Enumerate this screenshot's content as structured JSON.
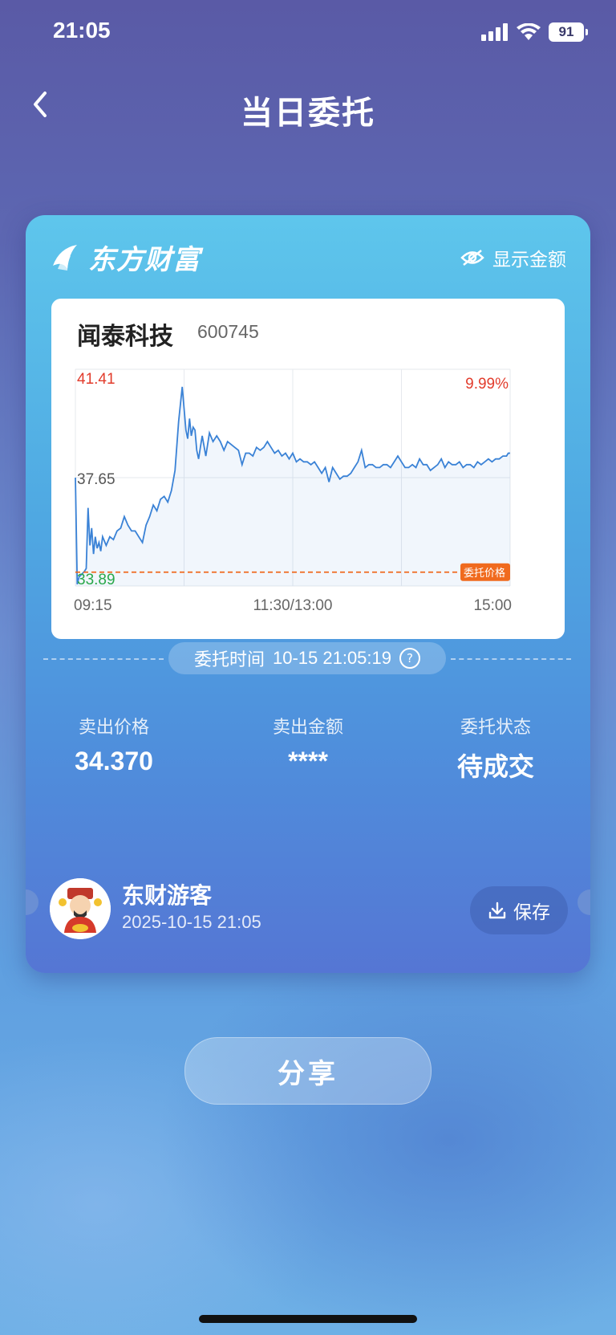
{
  "status_bar": {
    "time": "21:05",
    "battery": "91"
  },
  "nav": {
    "title": "当日委托"
  },
  "card": {
    "brand": "东方财富",
    "show_amount_label": "显示金额",
    "stock": {
      "name": "闻泰科技",
      "code": "600745"
    },
    "entrust_time_label": "委托时间",
    "entrust_time": "10-15 21:05:19",
    "stats": [
      {
        "label": "卖出价格",
        "value": "34.370"
      },
      {
        "label": "卖出金额",
        "value": "****"
      },
      {
        "label": "委托状态",
        "value": "待成交"
      }
    ],
    "user": {
      "name": "东财游客",
      "time": "2025-10-15 21:05"
    },
    "save_label": "保存"
  },
  "share_label": "分享",
  "colors": {
    "up": "#e23c2c",
    "down": "#2aa84a",
    "line": "#3a82d6",
    "entrust": "#f06a1e"
  },
  "chart_data": {
    "type": "line",
    "x_ticks": [
      "09:15",
      "11:30/13:00",
      "15:00"
    ],
    "y_high": "41.41",
    "y_mid": "37.65",
    "y_low": "33.89",
    "pct_high": "9.99%",
    "ylim": [
      33.89,
      41.41
    ],
    "entrust_price": 34.37,
    "entrust_label": "委托价格",
    "series": [
      {
        "x": [
          0,
          1,
          2,
          5,
          6,
          7,
          8,
          9,
          10,
          11,
          12,
          13,
          14,
          15,
          17,
          19,
          21,
          23,
          25,
          27,
          29,
          31,
          33,
          35,
          37,
          39,
          41,
          43,
          45,
          47,
          49,
          51,
          53,
          55,
          57,
          59,
          61,
          62,
          63,
          64,
          65,
          66,
          67,
          68,
          69,
          70,
          72,
          74,
          76,
          78,
          80,
          82,
          84,
          86,
          88,
          90,
          92,
          94,
          96,
          98,
          100,
          102,
          104,
          106,
          108,
          110,
          112,
          114,
          116,
          118,
          120,
          122,
          124,
          126,
          128,
          130,
          132,
          134,
          136,
          138,
          140,
          142,
          144,
          146,
          148,
          150,
          152,
          154,
          156,
          158,
          160,
          162,
          164,
          166,
          168,
          170,
          172,
          174,
          176,
          178,
          180,
          182,
          184,
          186,
          188,
          190,
          192,
          194,
          196,
          198,
          200,
          202,
          204,
          206,
          208,
          210,
          212,
          214,
          216,
          218,
          220,
          222,
          224,
          226,
          228,
          230,
          232,
          234,
          236,
          238,
          239,
          240
        ],
        "values": [
          37.65,
          33.95,
          34.2,
          34.4,
          34.5,
          36.6,
          35.3,
          35.9,
          35.0,
          35.6,
          35.2,
          35.4,
          35.1,
          35.6,
          35.3,
          35.6,
          35.5,
          35.8,
          35.9,
          36.3,
          36.0,
          35.8,
          35.8,
          35.6,
          35.4,
          36.0,
          36.3,
          36.7,
          36.5,
          36.9,
          37.0,
          36.8,
          37.2,
          37.9,
          39.6,
          40.8,
          39.3,
          39.0,
          39.7,
          39.1,
          39.4,
          39.3,
          38.6,
          38.3,
          38.7,
          39.1,
          38.4,
          39.2,
          38.9,
          39.1,
          38.9,
          38.6,
          38.9,
          38.8,
          38.7,
          38.6,
          38.1,
          38.5,
          38.5,
          38.4,
          38.7,
          38.6,
          38.7,
          38.9,
          38.7,
          38.5,
          38.6,
          38.4,
          38.5,
          38.3,
          38.5,
          38.2,
          38.3,
          38.2,
          38.2,
          38.1,
          38.2,
          38.0,
          37.8,
          38.0,
          37.5,
          38.0,
          37.8,
          37.6,
          37.7,
          37.7,
          37.8,
          38.0,
          38.2,
          38.6,
          38.0,
          38.1,
          38.1,
          38.0,
          38.0,
          38.1,
          38.1,
          38.0,
          38.2,
          38.4,
          38.2,
          38.0,
          38.0,
          38.1,
          38.0,
          38.3,
          38.1,
          38.1,
          37.9,
          38.0,
          38.1,
          38.3,
          38.0,
          38.2,
          38.1,
          38.1,
          38.2,
          38.0,
          38.1,
          38.1,
          38.0,
          38.2,
          38.1,
          38.2,
          38.3,
          38.2,
          38.3,
          38.3,
          38.4,
          38.4,
          38.5,
          38.5
        ]
      }
    ]
  }
}
